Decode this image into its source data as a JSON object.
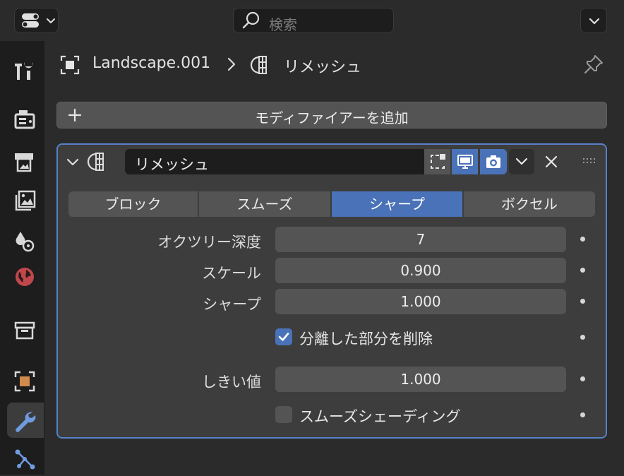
{
  "search": {
    "placeholder": "検索"
  },
  "breadcrumb": {
    "object": "Landscape.001",
    "modifier": "リメッシュ"
  },
  "add_modifier_label": "モディファイアーを追加",
  "modifier": {
    "name": "リメッシュ",
    "modes": [
      "ブロック",
      "スムーズ",
      "シャープ",
      "ボクセル"
    ],
    "active_mode": "シャープ",
    "octree_depth": {
      "label": "オクツリー深度",
      "value": "7"
    },
    "scale": {
      "label": "スケール",
      "value": "0.900"
    },
    "sharpness": {
      "label": "シャープ",
      "value": "1.000"
    },
    "remove_disconnected": {
      "label": "分離した部分を削除",
      "checked": true
    },
    "threshold": {
      "label": "しきい値",
      "value": "1.000"
    },
    "smooth_shading": {
      "label": "スムーズシェーディング",
      "checked": false
    }
  },
  "colors": {
    "accent": "#4a72b8",
    "panel_outline": "#5681c9",
    "world_icon": "#c0474b",
    "object_icon": "#d08a4b",
    "modifier_icon": "#6f9be0"
  },
  "sidebar_tabs": [
    "tool",
    "render",
    "output",
    "view-layer",
    "scene",
    "world",
    "collection",
    "object",
    "modifiers",
    "particles"
  ],
  "active_tab": "modifiers"
}
